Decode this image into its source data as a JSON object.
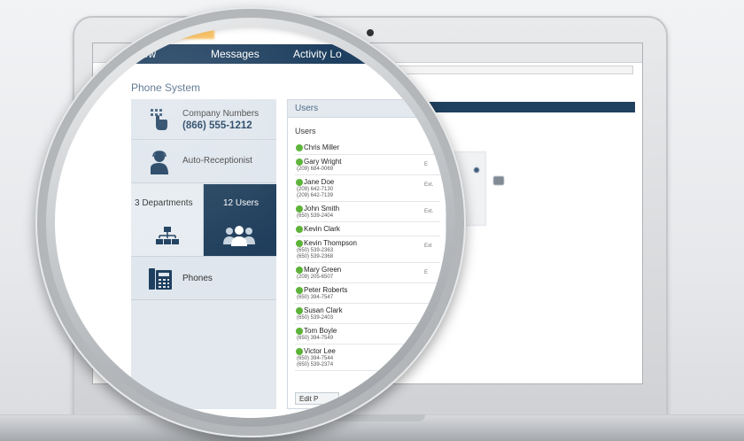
{
  "nav": {
    "items": [
      "rview",
      "Messages",
      "Activity Lo"
    ]
  },
  "page": {
    "title": "Phone System"
  },
  "tiles": {
    "company_label": "Company Numbers",
    "company_number": "(866) 555-1212",
    "auto_receptionist": "Auto-Receptionist",
    "departments": "3 Departments",
    "users": "12 Users",
    "phones": "Phones"
  },
  "users_panel": {
    "title": "Users",
    "subtitle": "Users",
    "edit_button": "Edit P",
    "list": [
      {
        "name": "Chris Miller",
        "phones": [],
        "ext": ""
      },
      {
        "name": "Gary Wright",
        "phones": [
          "(209) 684-0069"
        ],
        "ext": "E"
      },
      {
        "name": "Jane Doe",
        "phones": [
          "(209) 642-7130",
          "(209) 642-7139"
        ],
        "ext": "Ext."
      },
      {
        "name": "John Smith",
        "phones": [
          "(650) 539-2404"
        ],
        "ext": "Ext."
      },
      {
        "name": "Kevin Clark",
        "phones": [],
        "ext": ""
      },
      {
        "name": "Kevin Thompson",
        "phones": [
          "(650) 539-2363",
          "(650) 539-2368"
        ],
        "ext": "Ext"
      },
      {
        "name": "Mary Green",
        "phones": [
          "(209) 205-6507"
        ],
        "ext": "E"
      },
      {
        "name": "Peter Roberts",
        "phones": [
          "(650) 394-7547"
        ],
        "ext": ""
      },
      {
        "name": "Susan Clark",
        "phones": [
          "(650) 539-2403"
        ],
        "ext": ""
      },
      {
        "name": "Tom Boyle",
        "phones": [
          "(650) 394-7549"
        ],
        "ext": ""
      },
      {
        "name": "Victor Lee",
        "phones": [
          "(650) 394-7544",
          "(650) 539-2374"
        ],
        "ext": ""
      }
    ]
  },
  "colors": {
    "nav_bg": "#1e3f5f",
    "accent": "#f5a31a",
    "status_online": "#5cb338",
    "selected_tile": "#203f5c"
  },
  "icons": [
    "touch-keypad-icon",
    "receptionist-icon",
    "org-chart-icon",
    "users-group-icon",
    "desk-phone-icon",
    "status-dot-icon"
  ]
}
